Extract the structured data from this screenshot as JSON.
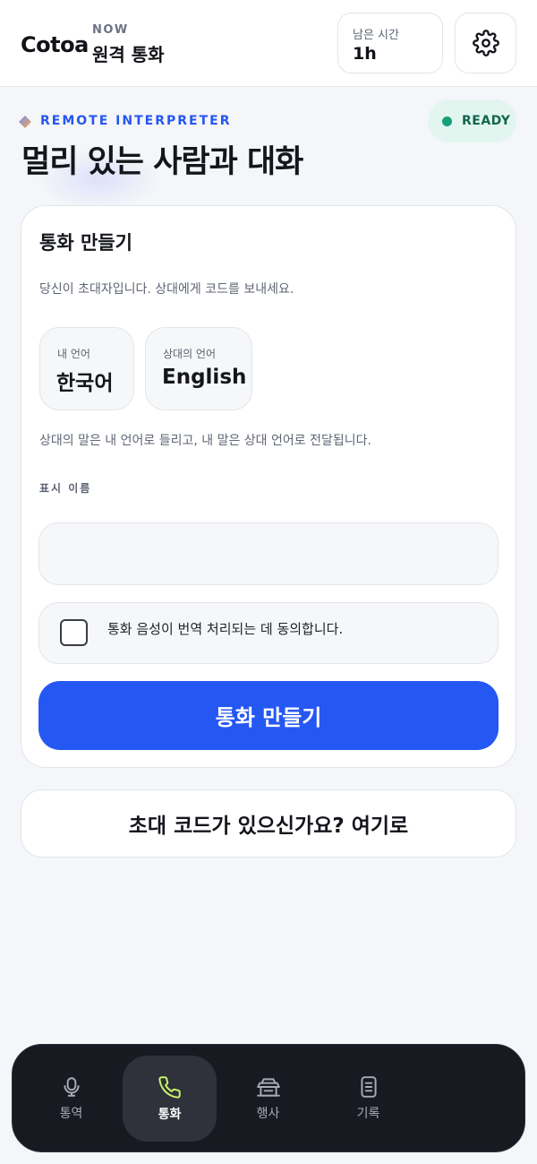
{
  "header": {
    "brand": "Cotoa",
    "now_label": "NOW",
    "now_title": "원격 통화",
    "time_label": "남은 시간",
    "time_value": "1h",
    "settings_icon": "gear-icon"
  },
  "hero": {
    "eyebrow": "REMOTE INTERPRETER",
    "status": "READY",
    "status_color": "#13a07a",
    "title": "멀리 있는 사람과 대화"
  },
  "card": {
    "title": "통화 만들기",
    "description": "당신이 초대자입니다. 상대에게 코드를 보내세요.",
    "my_language_label": "내 언어",
    "my_language_value": "한국어",
    "their_language_label": "상대의 언어",
    "their_language_value": "English",
    "language_note": "상대의 말은 내 언어로 들리고, 내 말은 상대 언어로 전달됩니다.",
    "name_label": "표시 이름",
    "name_value": "",
    "consent_text": "통화 음성이 번역 처리되는 데 동의합니다.",
    "consent_checked": false,
    "create_button": "통화 만들기"
  },
  "secondary_button": "초대 코드가 있으신가요? 여기로",
  "colors": {
    "accent": "#2557f3",
    "nav_background": "#181a22",
    "active_icon": "#c7f26b"
  },
  "nav": {
    "items": [
      {
        "label": "통역",
        "icon": "microphone-icon",
        "active": false
      },
      {
        "label": "통화",
        "icon": "phone-icon",
        "active": true
      },
      {
        "label": "행사",
        "icon": "podium-icon",
        "active": false
      },
      {
        "label": "기록",
        "icon": "document-icon",
        "active": false
      }
    ]
  }
}
